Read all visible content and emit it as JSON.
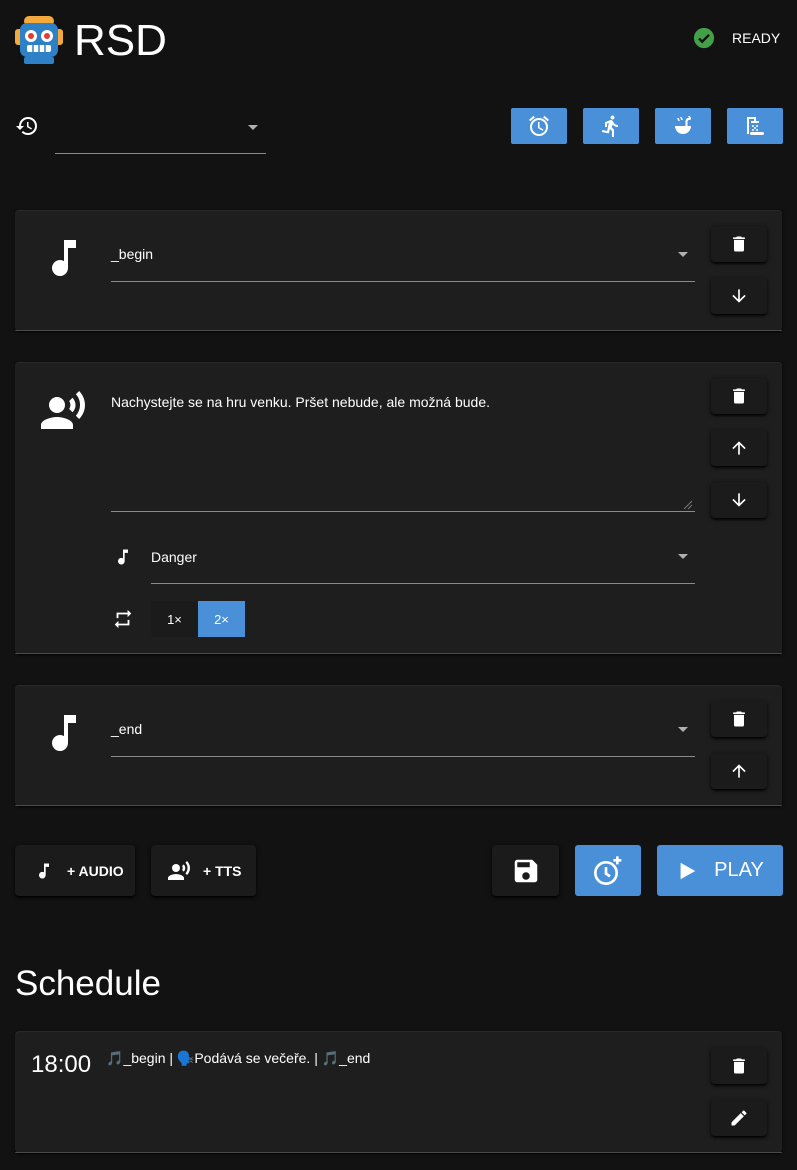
{
  "header": {
    "app_title": "RSD",
    "logo_icon": "robot-icon",
    "status_label": "READY",
    "status_icon": "check-circle-icon",
    "status_color": "#43a047"
  },
  "preset": {
    "history_icon": "history-icon",
    "value": "",
    "quick_buttons": [
      {
        "icon": "alarm-clock-icon"
      },
      {
        "icon": "running-person-icon"
      },
      {
        "icon": "soup-ladle-icon"
      },
      {
        "icon": "shower-icon"
      }
    ]
  },
  "playlist": {
    "items": [
      {
        "type": "audio",
        "icon": "music-note-icon",
        "value": "_begin",
        "actions": [
          "delete-icon",
          "arrow-down-icon"
        ]
      },
      {
        "type": "tts",
        "icon": "speaker-person-icon",
        "text": "Nachystejte se na hru venku. Pršet nebude, ale možná bude.",
        "background_icon": "music-note-icon",
        "background_value": "Danger",
        "repeat_icon": "repeat-icon",
        "repeat_options": [
          "1×",
          "2×"
        ],
        "repeat_selected": "2×",
        "actions": [
          "delete-icon",
          "arrow-up-icon",
          "arrow-down-icon"
        ]
      },
      {
        "type": "audio",
        "icon": "music-note-icon",
        "value": "_end",
        "actions": [
          "delete-icon",
          "arrow-up-icon"
        ]
      }
    ]
  },
  "actions": {
    "add_audio_label": "+ AUDIO",
    "add_tts_label": "+ TTS",
    "save_icon": "floppy-disk-icon",
    "schedule_icon": "clock-plus-icon",
    "play_label": "PLAY",
    "accent_color": "#4a90d9"
  },
  "schedule": {
    "heading": "Schedule",
    "entries": [
      {
        "time": "18:00",
        "segments": [
          {
            "icon": "🎵",
            "text": "_begin"
          },
          {
            "sep": " | "
          },
          {
            "icon": "🗣️",
            "text": "Podává se večeře."
          },
          {
            "sep": " | "
          },
          {
            "icon": "🎵",
            "text": "_end"
          }
        ],
        "actions": [
          "delete-icon",
          "pencil-icon"
        ]
      }
    ]
  }
}
